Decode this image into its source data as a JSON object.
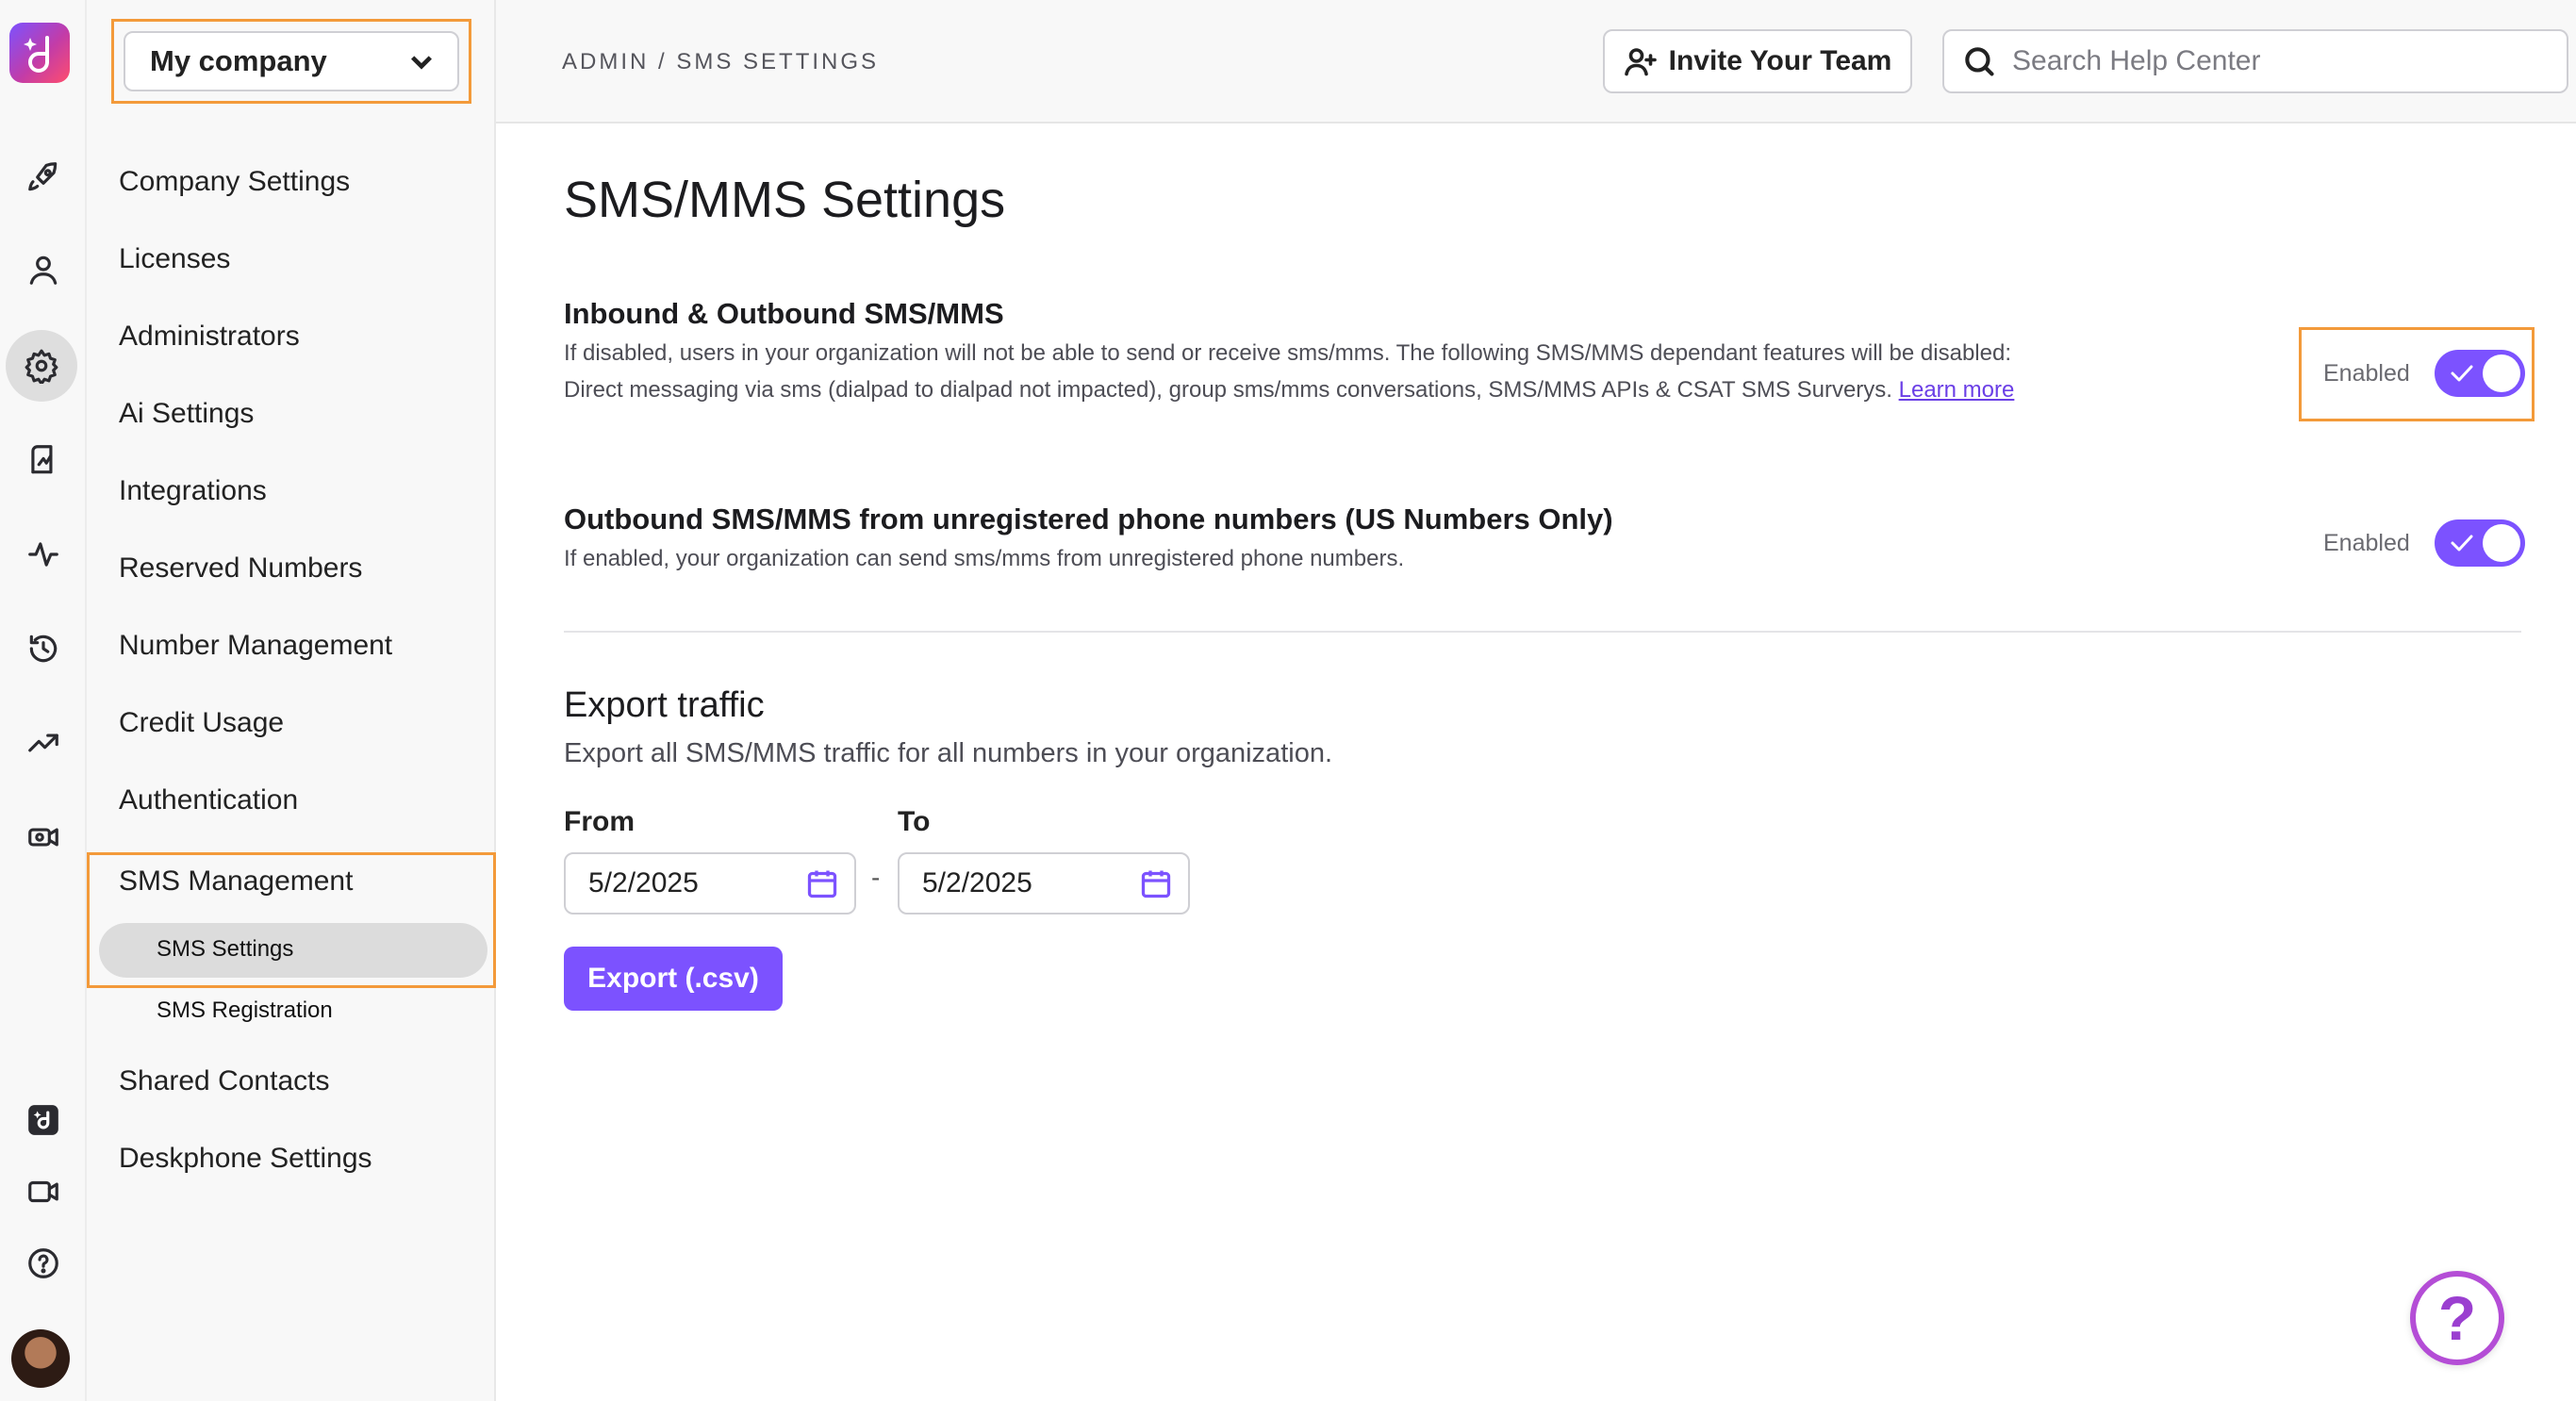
{
  "colors": {
    "accent": "#7c52ff",
    "highlight": "#f39a3a"
  },
  "rail": {
    "icons": [
      "dialpad-logo-icon",
      "rocket-icon",
      "user-icon",
      "gear-icon",
      "analytics-book-icon",
      "pulse-icon",
      "history-icon",
      "trend-icon",
      "video-settings-icon",
      "dialpad-app-icon",
      "video-camera-icon",
      "help-circle-icon",
      "avatar"
    ]
  },
  "sidebar": {
    "company": "My company",
    "items": [
      {
        "label": "Company Settings"
      },
      {
        "label": "Licenses"
      },
      {
        "label": "Administrators"
      },
      {
        "label": "Ai Settings"
      },
      {
        "label": "Integrations"
      },
      {
        "label": "Reserved Numbers"
      },
      {
        "label": "Number Management"
      },
      {
        "label": "Credit Usage"
      },
      {
        "label": "Authentication"
      },
      {
        "label": "SMS Management"
      },
      {
        "label": "Shared Contacts"
      },
      {
        "label": "Deskphone Settings"
      }
    ],
    "sms_sub": [
      {
        "label": "SMS Settings"
      },
      {
        "label": "SMS Registration"
      }
    ]
  },
  "topbar": {
    "breadcrumb": "ADMIN / SMS SETTINGS",
    "invite_label": "Invite Your Team",
    "search_placeholder": "Search Help Center"
  },
  "main": {
    "title": "SMS/MMS Settings",
    "settings": [
      {
        "title": "Inbound & Outbound SMS/MMS",
        "desc": "If disabled, users in your organization will not be able to send or receive sms/mms. The following SMS/MMS dependant features will be disabled: Direct messaging via sms (dialpad to dialpad not impacted), group sms/mms conversations, SMS/MMS APIs & CSAT SMS Surverys.",
        "link": "Learn more",
        "status": "Enabled",
        "enabled": true
      },
      {
        "title": "Outbound SMS/MMS from unregistered phone numbers (US Numbers Only)",
        "desc": "If enabled, your organization can send sms/mms from unregistered phone numbers.",
        "status": "Enabled",
        "enabled": true
      }
    ],
    "export": {
      "title": "Export traffic",
      "desc": "Export all SMS/MMS traffic for all numbers in your organization.",
      "from_label": "From",
      "to_label": "To",
      "from_value": "5/2/2025",
      "to_value": "5/2/2025",
      "separator": "-",
      "button": "Export (.csv)"
    }
  },
  "help_fab": "?"
}
